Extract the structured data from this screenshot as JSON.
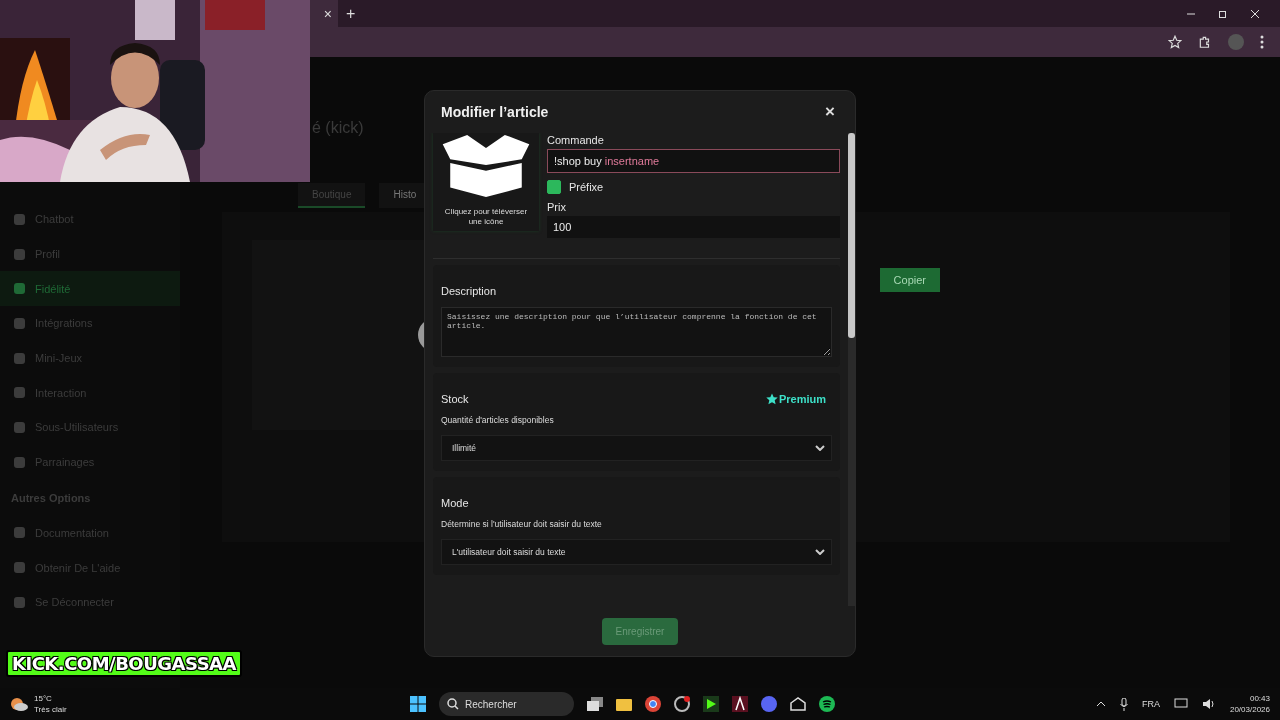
{
  "browser": {
    "tab_close": "×",
    "new_tab": "+"
  },
  "page": {
    "title": "é (kick)",
    "tabs": [
      {
        "label": "Boutique",
        "selected": true
      },
      {
        "label": "Histo",
        "selected": false
      }
    ],
    "sidebar": {
      "items": [
        {
          "label": "Chatbot",
          "selected": false
        },
        {
          "label": "Profil",
          "selected": false
        },
        {
          "label": "Fidélité",
          "selected": true
        },
        {
          "label": "Intégrations",
          "selected": false
        },
        {
          "label": "Mini-Jeux",
          "selected": false
        },
        {
          "label": "Interaction",
          "selected": false
        },
        {
          "label": "Sous-Utilisateurs",
          "selected": false
        },
        {
          "label": "Parrainages",
          "selected": false
        }
      ],
      "section": "Autres Options",
      "other_items": [
        "Documentation",
        "Obtenir De L'aide",
        "Se Déconnecter"
      ]
    },
    "copy_button": "Copier"
  },
  "overlay": {
    "channel": "KICK.COM/BOUGASSAA"
  },
  "modal": {
    "title": "Modifier l’article",
    "close": "×",
    "upload_caption": "Cliquez pour téléverser une icône",
    "command": {
      "label": "Commande",
      "value": "!shop buy",
      "variable": "insertname"
    },
    "prefix": {
      "label": "Préfixe",
      "checked": true
    },
    "price": {
      "label": "Prix",
      "value": "100"
    },
    "description": {
      "label": "Description",
      "placeholder": "Saisissez une description pour que l’utilisateur comprenne la fonction de cet article."
    },
    "stock": {
      "label": "Stock",
      "badge": "Premium",
      "hint": "Quantité d'articles disponibles",
      "value": "Illimité"
    },
    "mode": {
      "label": "Mode",
      "hint": "Détermine si l'utilisateur doit saisir du texte",
      "value": "L'utilisateur doit saisir du texte"
    },
    "save": "Enregistrer"
  },
  "taskbar": {
    "temp": "15°C",
    "weather": "Très clair",
    "search": "Rechercher",
    "lang": "FRA",
    "time": "00:43",
    "date": "20/03/2026"
  }
}
